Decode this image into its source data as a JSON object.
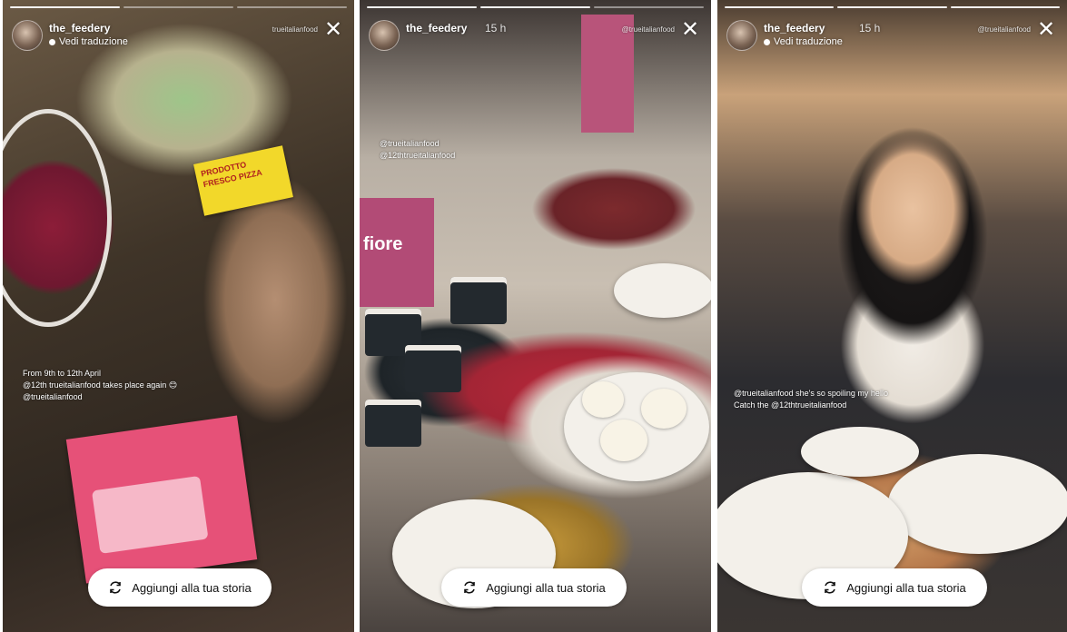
{
  "stories": [
    {
      "username": "the_feedery",
      "time": "",
      "subline": "Vedi traduzione",
      "top_tag": "trueitalianfood",
      "mentions": [
        "From 9th to 12th April",
        "@12th trueitalianfood takes place again 😊",
        "@trueitalianfood"
      ],
      "sign_text": "PRODOTTO FRESCO PIZZA",
      "add_button_label": "Aggiungi alla tua storia",
      "progress": [
        1,
        0,
        0
      ]
    },
    {
      "username": "the_feedery",
      "time": "15 h",
      "top_tag": "@trueitalianfood",
      "mentions": [
        "@trueitalianfood",
        "@12thtrueitalianfood"
      ],
      "banner_text": "fiore",
      "add_button_label": "Aggiungi alla tua storia",
      "progress": [
        1,
        1,
        0
      ]
    },
    {
      "username": "the_feedery",
      "time": "15 h",
      "subline": "Vedi traduzione",
      "top_tag": "@trueitalianfood",
      "mentions": [
        "@trueitalianfood  she's so spoiling my hello",
        "Catch the @12thtrueitalianfood"
      ],
      "add_button_label": "Aggiungi alla tua storia",
      "progress": [
        1,
        1,
        1
      ]
    }
  ]
}
